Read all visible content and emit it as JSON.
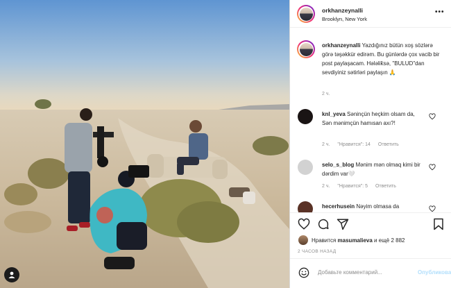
{
  "header": {
    "username": "orkhanzeynalli",
    "location": "Brooklyn, New York"
  },
  "caption": {
    "username": "orkhanzeynalli",
    "text": "Yazdığınız bütün xoş sözlərə görə təşəkkür edirəm. Bu günlərdə çox vacib bir post paylaşacam. Hələlik̈sə, \"BULUD\"dan sevdiyiniz sətirləri paylaşın 🙏",
    "time": "2 ч."
  },
  "comments": [
    {
      "username": "knl_yeva",
      "text": "Səninçün heçkim olsam da,\nSən mənimçün hamısan axı?!",
      "time": "2 ч.",
      "likes": "\"Нравится\": 14",
      "reply": "Ответить",
      "avatar_color": "#1a1414"
    },
    {
      "username": "selo_s_blog",
      "text": "Mənim mən olmaq kimi bir dərdim var🤍",
      "time": "2 ч.",
      "likes": "\"Нравится\": 5",
      "reply": "Ответить",
      "avatar_color": "#d2d2d2"
    },
    {
      "username": "hecerhusein",
      "text": "Nəyim olmasa da",
      "time": "",
      "likes": "",
      "reply": "",
      "avatar_color": "#5a3226"
    }
  ],
  "likes": {
    "prefix": "Нравится",
    "user": "masumalieva",
    "suffix": "и ещё 2 882"
  },
  "time_ago": "2 ЧАСОВ НАЗАД",
  "comment_input": {
    "placeholder": "Добавьте комментарий...",
    "publish_label": "Опубликовать"
  },
  "colors": {
    "accent": "#0095f6",
    "publish_disabled": "#b2dffc",
    "secondary_text": "#8e8e8e",
    "border": "#dbdbdb"
  },
  "icons": [
    "more-options-icon",
    "heart-icon",
    "comment-icon",
    "share-icon",
    "bookmark-icon",
    "emoji-icon",
    "user-tag-icon"
  ]
}
